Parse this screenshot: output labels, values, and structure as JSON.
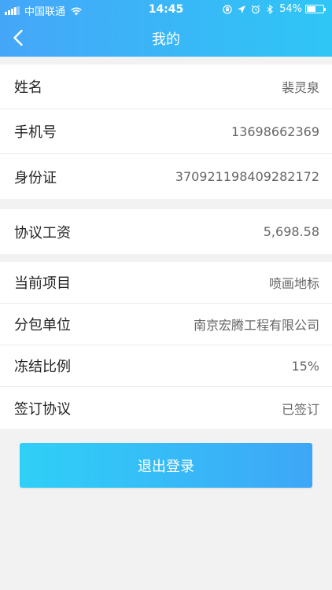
{
  "status_bar": {
    "carrier": "中国联通",
    "time": "14:45",
    "battery": "54%",
    "battery_level": 0.54
  },
  "nav": {
    "title": "我的",
    "back_icon": "chevron-left-icon"
  },
  "groups": [
    [
      {
        "label": "姓名",
        "value": "裴灵泉"
      },
      {
        "label": "手机号",
        "value": "13698662369"
      },
      {
        "label": "身份证",
        "value": "370921198409282172"
      }
    ],
    [
      {
        "label": "协议工资",
        "value": "5,698.58"
      }
    ],
    [
      {
        "label": "当前项目",
        "value": "喷画地标"
      },
      {
        "label": "分包单位",
        "value": "南京宏腾工程有限公司"
      },
      {
        "label": "冻结比例",
        "value": "15%"
      },
      {
        "label": "签订协议",
        "value": "已签订"
      }
    ]
  ],
  "logout_label": "退出登录",
  "colors": {
    "header_start": "#45a6f8",
    "header_end": "#2fc6f6",
    "button_start": "#2fd0f7",
    "button_end": "#3ea6f7"
  }
}
